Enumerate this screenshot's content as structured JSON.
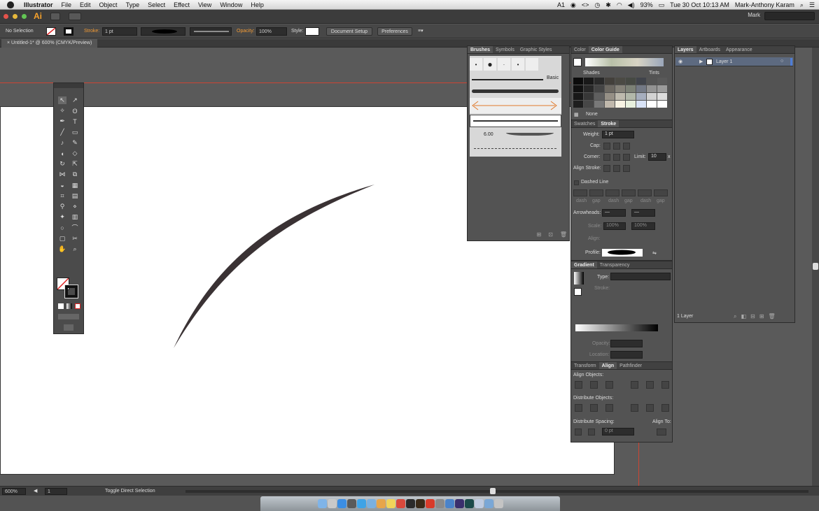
{
  "menubar": {
    "items": [
      "Illustrator",
      "File",
      "Edit",
      "Object",
      "Type",
      "Select",
      "Effect",
      "View",
      "Window",
      "Help"
    ],
    "right": {
      "ai_status": "1",
      "battery": "93%",
      "clock": "Tue 30 Oct  10:13 AM",
      "user": "Mark-Anthony Karam"
    }
  },
  "appbar": {
    "logo": "Ai",
    "workspace": "Mark"
  },
  "control": {
    "selection": "No Selection",
    "stroke_label": "Stroke:",
    "stroke_weight": "1 pt",
    "opacity_label": "Opacity:",
    "opacity": "100%",
    "style_label": "Style:",
    "doc_setup": "Document Setup",
    "preferences": "Preferences"
  },
  "document": {
    "tab": "Untitled-1* @ 600% (CMYK/Preview)"
  },
  "status": {
    "zoom": "600%",
    "artboard": "1",
    "tool": "Toggle Direct Selection"
  },
  "brushes": {
    "tabs": [
      "Brushes",
      "Symbols",
      "Graphic Styles"
    ],
    "basic_label": "Basic",
    "size_value": "6.00"
  },
  "color": {
    "tabs": [
      "Color",
      "Color Guide"
    ],
    "shades": "Shades",
    "tints": "Tints",
    "none": "None"
  },
  "stroke_panel": {
    "tabs": [
      "Swatches",
      "Stroke"
    ],
    "weight_label": "Weight:",
    "weight": "1 pt",
    "cap_label": "Cap:",
    "corner_label": "Corner:",
    "limit_label": "Limit:",
    "limit": "10",
    "limit_unit": "x",
    "align_label": "Align Stroke:",
    "dashed": "Dashed Line",
    "dash_labels": [
      "dash",
      "gap",
      "dash",
      "gap",
      "dash",
      "gap"
    ],
    "arrowheads": "Arrowheads:",
    "scale": "Scale:",
    "scale_v1": "100%",
    "scale_v2": "100%",
    "align2": "Align:",
    "profile": "Profile:"
  },
  "gradient": {
    "tabs": [
      "Gradient",
      "Transparency"
    ],
    "type": "Type:",
    "stroke": "Stroke:",
    "opacity": "Opacity:",
    "location": "Location:"
  },
  "align": {
    "tabs": [
      "Transform",
      "Align",
      "Pathfinder"
    ],
    "objects": "Align Objects:",
    "distribute": "Distribute Objects:",
    "spacing": "Distribute Spacing:",
    "align_to": "Align To:",
    "spacing_value": "0 pt"
  },
  "layers": {
    "tabs": [
      "Layers",
      "Artboards",
      "Appearance"
    ],
    "layer_name": "Layer 1",
    "count": "1 Layer"
  },
  "colors": {
    "accent": "#f39b35",
    "artboard": "#ffffff",
    "pasteboard": "#5a5a5a",
    "stroke": "#3a3234",
    "guide": "#cc4433",
    "layer": "#4f7dd6"
  }
}
